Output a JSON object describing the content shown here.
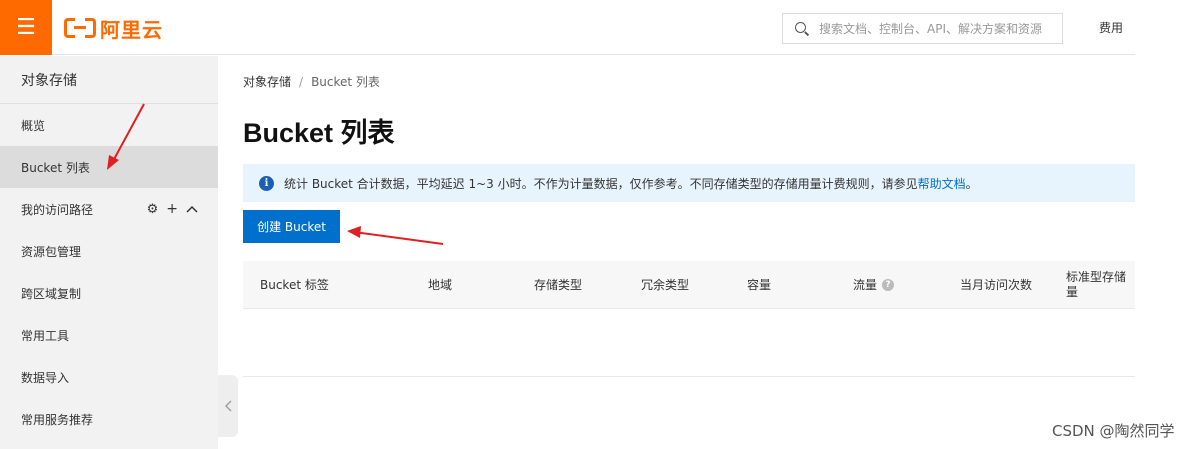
{
  "header": {
    "logo_text": "阿里云",
    "search_placeholder": "搜索文档、控制台、API、解决方案和资源",
    "fees_label": "费用"
  },
  "sidebar": {
    "title": "对象存储",
    "items": [
      {
        "label": "概览"
      },
      {
        "label": "Bucket 列表"
      },
      {
        "label": "我的访问路径"
      },
      {
        "label": "资源包管理"
      },
      {
        "label": "跨区域复制"
      },
      {
        "label": "常用工具"
      },
      {
        "label": "数据导入"
      },
      {
        "label": "常用服务推荐"
      }
    ],
    "active_index": 1
  },
  "main": {
    "breadcrumb": [
      "对象存储",
      "Bucket 列表"
    ],
    "title": "Bucket 列表",
    "notice": {
      "text": "统计 Bucket 合计数据，平均延迟 1~3 小时。不作为计量数据，仅作参考。不同存储类型的存储用量计费规则，请参见",
      "link": "帮助文档",
      "suffix": "。"
    },
    "create_button": "创建 Bucket",
    "table": {
      "columns": [
        {
          "label": "Bucket 标签"
        },
        {
          "label": "地域"
        },
        {
          "label": "存储类型"
        },
        {
          "label": "冗余类型"
        },
        {
          "label": "容量"
        },
        {
          "label": "流量"
        },
        {
          "label": "当月访问次数"
        },
        {
          "label": "标准型存储量"
        }
      ],
      "rows": []
    }
  },
  "colors": {
    "brand": "#ff6a00",
    "primary": "#0070cc",
    "annotation": "#e02020"
  },
  "watermark": "CSDN @陶然同学"
}
